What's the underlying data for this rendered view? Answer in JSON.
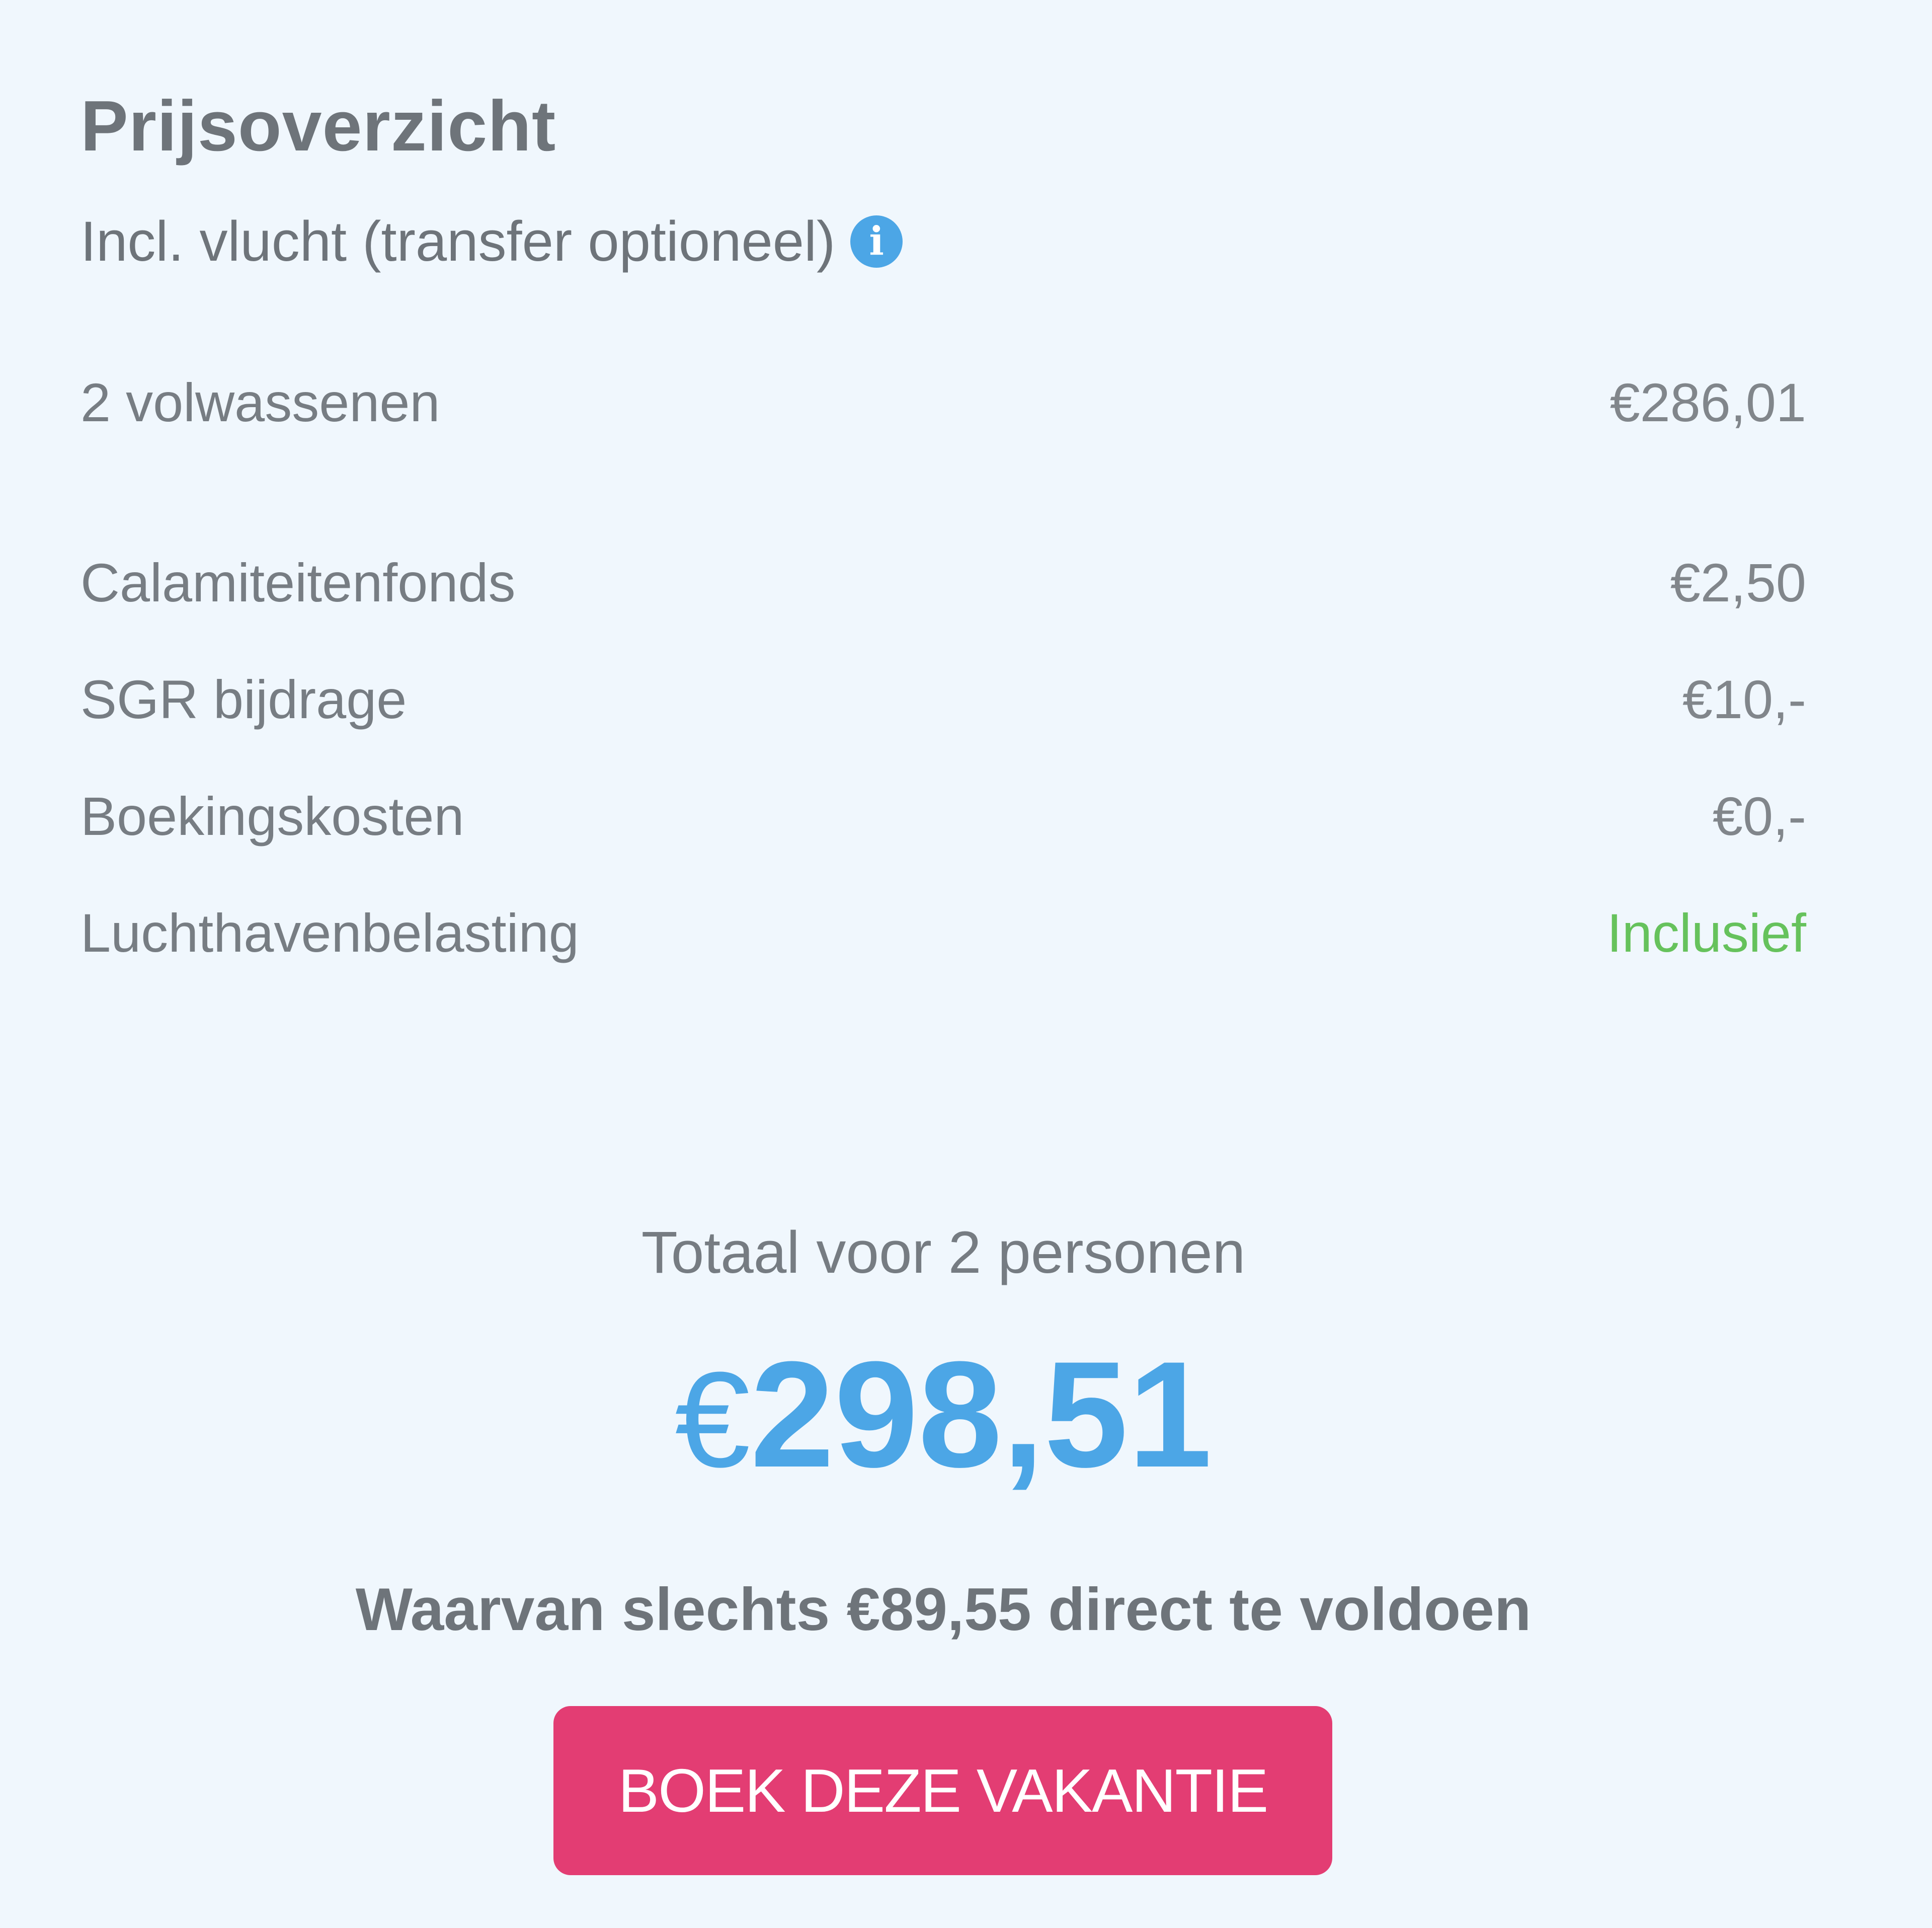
{
  "price_overview": {
    "title": "Prijsoverzicht",
    "subtitle": "Incl. vlucht (transfer optioneel)",
    "info_icon": "info-icon",
    "lines": [
      {
        "label": "2 volwassenen",
        "amount": "€286,01"
      },
      {
        "label": "Calamiteitenfonds",
        "amount": "€2,50"
      },
      {
        "label": "SGR bijdrage",
        "amount": "€10,-"
      },
      {
        "label": "Boekingskosten",
        "amount": "€0,-"
      },
      {
        "label": "Luchthavenbelasting",
        "amount": "Inclusief"
      }
    ],
    "total_label": "Totaal voor 2 personen",
    "total_currency": "€",
    "total_value": "298,51",
    "deposit_text": "Waarvan slechts €89,55 direct te voldoen",
    "book_button": "BOEK DEZE VAKANTIE"
  },
  "colors": {
    "background": "#f0f7fd",
    "accent_blue": "#4ca6e6",
    "included_green": "#66c25c",
    "button_pink": "#e33d73",
    "text_gray": "#6e747a"
  }
}
